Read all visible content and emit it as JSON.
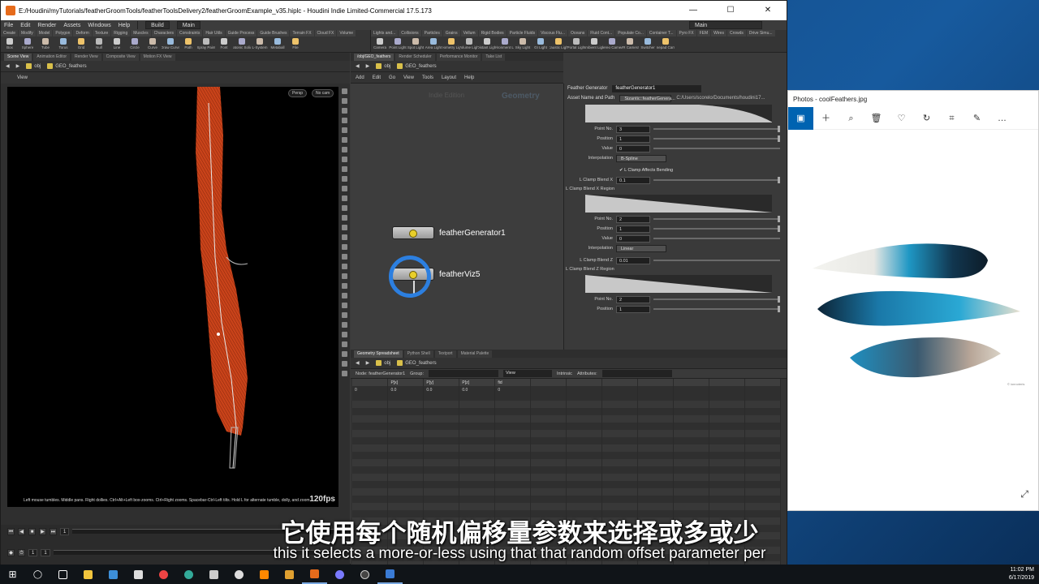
{
  "houdini": {
    "title": "E:/Houdini/myTutorials/featherGroomTools/featherToolsDelivery2/featherGroomExample_v35.hiplc - Houdini Indie Limited-Commercial 17.5.173",
    "menu": [
      "File",
      "Edit",
      "Render",
      "Assets",
      "Windows",
      "Help"
    ],
    "build_label": "Build",
    "main_label": "Main",
    "desk_label": "Main",
    "shelf_tabs_left": [
      "Create",
      "Modify",
      "Model",
      "Polygon",
      "Deform",
      "Texture",
      "Rigging",
      "Muscles",
      "Characters",
      "Constraints",
      "Hair Utils",
      "Guide Process",
      "Guide Brushes",
      "Terrain FX",
      "Cloud FX",
      "Volume"
    ],
    "shelf_tabs_right": [
      "Lights and...",
      "Collisions",
      "Particles",
      "Grains",
      "Vellum",
      "Rigid Bodies",
      "Particle Fluids",
      "Viscous Flu...",
      "Oceans",
      "Fluid Cont...",
      "Populate Co...",
      "Container T...",
      "Pyro FX",
      "FEM",
      "Wires",
      "Crowds",
      "Drive Simu..."
    ],
    "shelf_tools_left": [
      "Box",
      "Sphere",
      "Tube",
      "Torus",
      "Grid",
      "Null",
      "Line",
      "Circle",
      "Curve",
      "Draw Curve",
      "Path",
      "Spray Paint",
      "Font",
      "Platonic Solids",
      "L-System",
      "Metaball",
      "File"
    ],
    "shelf_tools_right": [
      "Camera",
      "Point Light",
      "Spot Light",
      "Area Light",
      "Geometry Light",
      "Volume Light",
      "Distant Light",
      "Environment Light",
      "Sky Light",
      "GI Light",
      "Caustic Light",
      "Portal Light",
      "Ambient Light",
      "Stereo Camera",
      "VR Camera",
      "Switcher",
      "Gamepad Camera"
    ]
  },
  "viewer": {
    "tabs": [
      "Scene View",
      "Animation Editor",
      "Render View",
      "Composite View",
      "Motion FX View"
    ],
    "path": [
      "obj",
      "GEO_feathers"
    ],
    "view_label": "View",
    "persp_label": "Persp",
    "cam_label": "No cam",
    "hint": "Left mouse tumbles. Middle pans. Right dollies. Ctrl+Alt+Left box-zooms. Ctrl+Right zooms. Spacebar-Ctrl-Left tilts. Hold L for alternate tumble, dolly, and zoom.",
    "fps": "120fps"
  },
  "timeline": {
    "frame": "1",
    "start": "1",
    "end": "1",
    "tick_labels": [
      "1",
      "72",
      "144",
      "216",
      "240"
    ]
  },
  "network": {
    "tabs": [
      "/obj/GEO_feathers",
      "Render Scheduler",
      "Performance Monitor",
      "Take List"
    ],
    "path": [
      "obj",
      "GEO_feathers"
    ],
    "menu": [
      "Add",
      "Edit",
      "Go",
      "View",
      "Tools",
      "Layout",
      "Help"
    ],
    "watermark_left": "Indie Edition",
    "watermark_right": "Geometry",
    "nodes": [
      {
        "name": "featherGenerator1"
      },
      {
        "name": "featherViz5"
      }
    ]
  },
  "params": {
    "type_label": "Feather Generator",
    "node_name": "featherGenerator1",
    "asset_label": "Asset Name and Path",
    "asset_name": "Sizantic::featherGenera...",
    "asset_path": "C:/Users/scorelo/Documents/houdini17...",
    "block1": {
      "point_label": "Point No.",
      "point": "3",
      "position_label": "Position",
      "position": "1",
      "value_label": "Value",
      "value": "0",
      "interp_label": "Interpolation",
      "interp": "B-Spline"
    },
    "check_label": "L Clamp Affects Bending",
    "blend_x_label": "L Clamp Blend X",
    "blend_x": "0.1",
    "region_y_label": "L Clamp Blend X Region",
    "block2": {
      "point_label": "Point No.",
      "point": "2",
      "position_label": "Position",
      "position": "1",
      "value_label": "Value",
      "value": "0",
      "interp_label": "Interpolation",
      "interp": "Linear"
    },
    "blend_z_label": "L Clamp Blend Z",
    "blend_z": "0.01",
    "region_z_label": "L Clamp Blend Z Region",
    "block3": {
      "point_label": "Point No.",
      "point": "2",
      "position_label": "Position",
      "position": "1"
    }
  },
  "sheet": {
    "tabs": [
      "Geometry Spreadsheet",
      "Python Shell",
      "Textport",
      "Material Palette"
    ],
    "path": [
      "obj",
      "GEO_feathers"
    ],
    "node_label": "Node: featherGenerator1",
    "group_label": "Group:",
    "view_label": "View",
    "intrinsic_label": "Intrinsic",
    "attributes_label": "Attributes:",
    "columns": [
      "",
      "P[x]",
      "P[y]",
      "P[z]",
      "fid"
    ],
    "row": [
      "0",
      "0.0",
      "0.0",
      "0.0",
      "0"
    ]
  },
  "photos": {
    "title": "Photos - coolFeathers.jpg",
    "toolbar": [
      "image-icon",
      "plus-icon",
      "zoom-icon",
      "delete-icon",
      "heart-icon",
      "rotate-icon",
      "crop-icon",
      "edit-icon",
      "more-icon"
    ],
    "watermark": "© ionnoteris"
  },
  "subtitle_cn": "它使用每个随机偏移量参数来选择或多或少",
  "subtitle_en": "this it selects a more-or-less using that that random offset parameter per",
  "clock": {
    "time": "11:02 PM",
    "date": "6/17/2019"
  },
  "colors": {
    "feather_orange": "#d84a1e",
    "accent_blue": "#0063b1",
    "select_ring": "#2c7fe0"
  }
}
